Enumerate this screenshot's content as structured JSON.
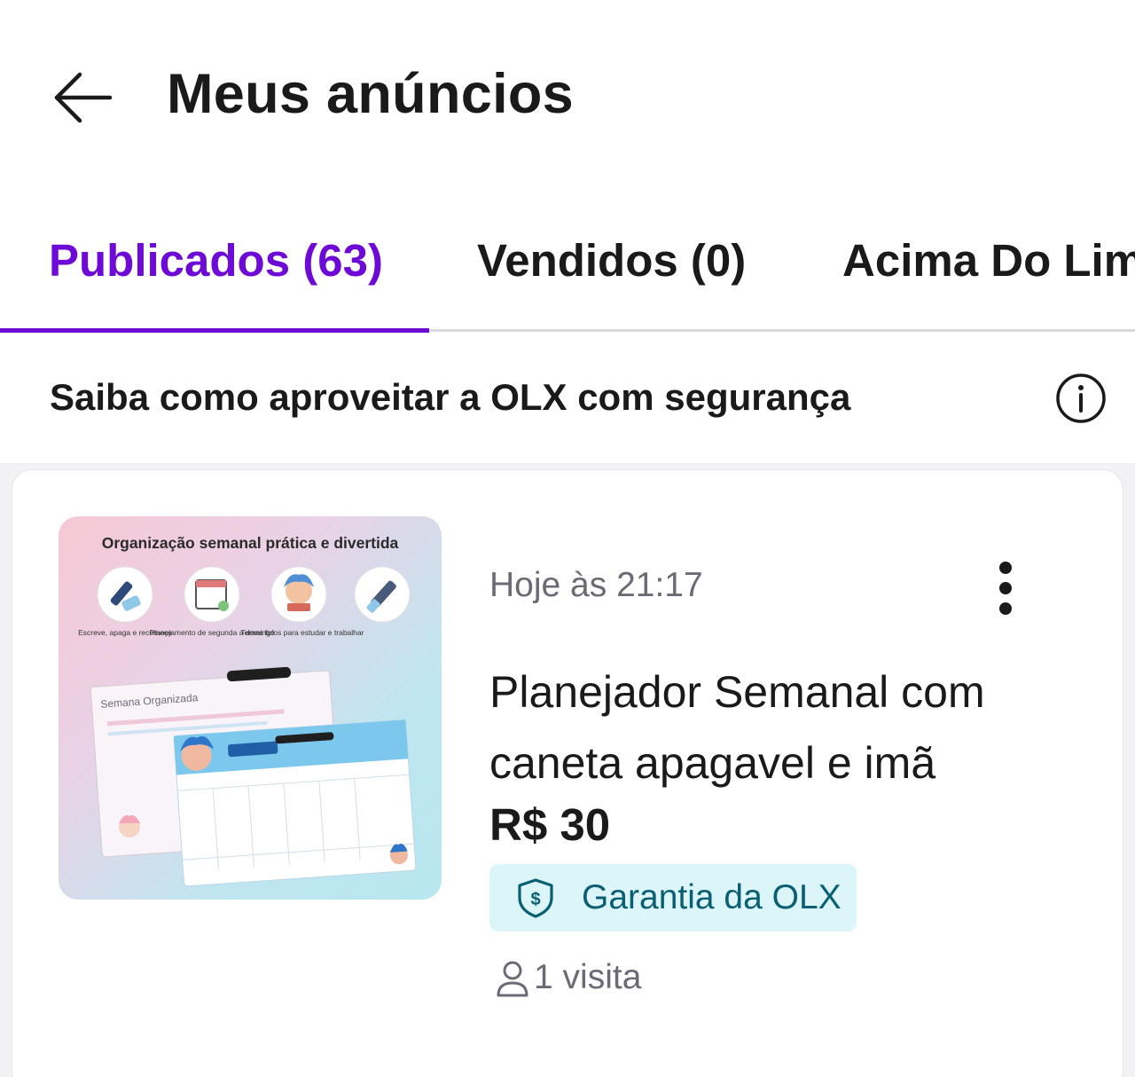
{
  "header": {
    "title": "Meus anúncios",
    "back_icon": "arrow-left-icon"
  },
  "tabs": [
    {
      "label": "Publicados (63)",
      "active": true
    },
    {
      "label": "Vendidos (0)",
      "active": false
    },
    {
      "label": "Acima Do Lim",
      "active": false
    }
  ],
  "safety": {
    "text": "Saiba como aproveitar a OLX com segurança",
    "icon": "info-icon"
  },
  "listing": {
    "thumbnail": {
      "headline": "Organização semanal prática e divertida",
      "features": [
        "Escreve, apaga e recomeça",
        "Planejamento de segunda a domingo",
        "Temas fofos para estudar e trabalhar"
      ],
      "board_label": "Semana Organizada"
    },
    "date": "Hoje às 21:17",
    "title": "Planejador Semanal com caneta apagavel e imã",
    "price": "R$ 30",
    "badge": "Garantia da OLX",
    "badge_icon": "shield-dollar-icon",
    "visits": "1 visita",
    "visits_icon": "person-icon",
    "menu_icon": "more-vertical-icon"
  },
  "colors": {
    "accent": "#6d0ad6",
    "badge_bg": "#dcf5f8",
    "badge_text": "#0a5f73",
    "muted": "#6b6b75"
  }
}
